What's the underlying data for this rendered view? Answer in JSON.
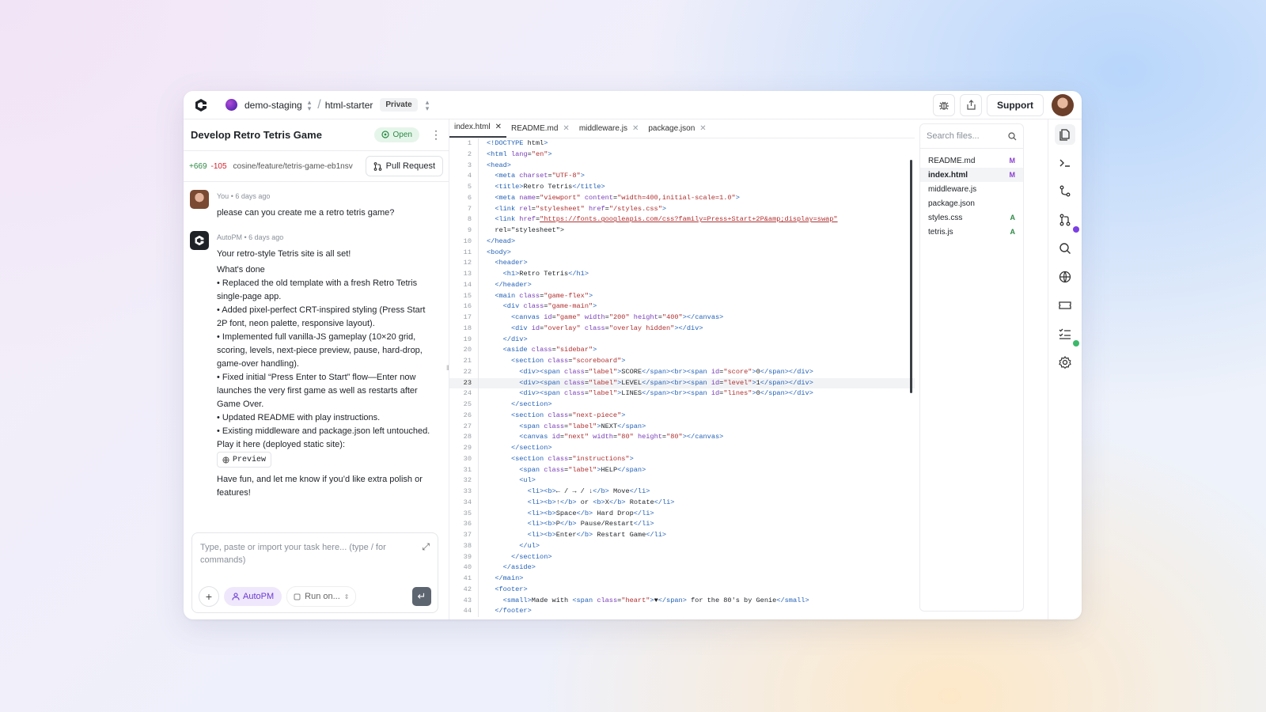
{
  "header": {
    "workspace": "demo-staging",
    "repo": "html-starter",
    "visibility": "Private",
    "support_label": "Support"
  },
  "task": {
    "title": "Develop Retro Tetris Game",
    "status": "Open",
    "additions": "+669",
    "deletions": "-105",
    "branch": "cosine/feature/tetris-game-eb1nsv",
    "pr_label": "Pull Request"
  },
  "messages": [
    {
      "author": "You",
      "time": "6 days ago",
      "lines": [
        "please can you create me a retro tetris game?"
      ]
    },
    {
      "author": "AutoPM",
      "time": "6 days ago",
      "lines": [
        "Your retro-style Tetris site is all set!",
        "What's done",
        "• Replaced the old template with a fresh Retro Tetris single-page app.",
        "• Added pixel-perfect CRT-inspired styling (Press Start 2P font, neon palette, responsive layout).",
        "• Implemented full vanilla-JS gameplay (10×20 grid, scoring, levels, next-piece preview, pause, hard-drop, game-over handling).",
        "• Fixed initial “Press Enter to Start” flow—Enter now launches the very first game as well as restarts after Game Over.",
        "• Updated README with play instructions.",
        "• Existing middleware and package.json left untouched.",
        "Play it here (deployed static site):"
      ],
      "preview_label": "Preview",
      "closing": "Have fun, and let me know if you’d like extra polish or features!"
    }
  ],
  "composer": {
    "placeholder": "Type, paste or import your task here... (type / for commands)",
    "agent_label": "AutoPM",
    "run_label": "Run on..."
  },
  "tabs": [
    {
      "label": "index.html",
      "active": true
    },
    {
      "label": "README.md",
      "active": false
    },
    {
      "label": "middleware.js",
      "active": false
    },
    {
      "label": "package.json",
      "active": false
    }
  ],
  "code": {
    "current_line": 23,
    "lines": [
      "<!DOCTYPE html>",
      "<html lang=\"en\">",
      "<head>",
      "  <meta charset=\"UTF-8\">",
      "  <title>Retro Tetris</title>",
      "  <meta name=\"viewport\" content=\"width=400,initial-scale=1.0\">",
      "  <link rel=\"stylesheet\" href=\"/styles.css\">",
      "  <link href=\"https://fonts.googleapis.com/css?family=Press+Start+2P&amp;display=swap\"",
      "  rel=\"stylesheet\">",
      "</head>",
      "<body>",
      "  <header>",
      "    <h1>Retro Tetris</h1>",
      "  </header>",
      "  <main class=\"game-flex\">",
      "    <div class=\"game-main\">",
      "      <canvas id=\"game\" width=\"200\" height=\"400\"></canvas>",
      "      <div id=\"overlay\" class=\"overlay hidden\"></div>",
      "    </div>",
      "    <aside class=\"sidebar\">",
      "      <section class=\"scoreboard\">",
      "        <div><span class=\"label\">SCORE</span><br><span id=\"score\">0</span></div>",
      "        <div><span class=\"label\">LEVEL</span><br><span id=\"level\">1</span></div>",
      "        <div><span class=\"label\">LINES</span><br><span id=\"lines\">0</span></div>",
      "      </section>",
      "      <section class=\"next-piece\">",
      "        <span class=\"label\">NEXT</span>",
      "        <canvas id=\"next\" width=\"80\" height=\"80\"></canvas>",
      "      </section>",
      "      <section class=\"instructions\">",
      "        <span class=\"label\">HELP</span>",
      "        <ul>",
      "          <li><b>← / → / ↓</b> Move</li>",
      "          <li><b>↑</b> or <b>X</b> Rotate</li>",
      "          <li><b>Space</b> Hard Drop</li>",
      "          <li><b>P</b> Pause/Restart</li>",
      "          <li><b>Enter</b> Restart Game</li>",
      "        </ul>",
      "      </section>",
      "    </aside>",
      "  </main>",
      "  <footer>",
      "    <small>Made with <span class=\"heart\">♥</span> for the 80's by Genie</small>",
      "  </footer>"
    ]
  },
  "files": {
    "search_placeholder": "Search files...",
    "items": [
      {
        "name": "README.md",
        "status": "M",
        "active": false
      },
      {
        "name": "index.html",
        "status": "M",
        "active": true
      },
      {
        "name": "middleware.js",
        "status": "",
        "active": false
      },
      {
        "name": "package.json",
        "status": "",
        "active": false
      },
      {
        "name": "styles.css",
        "status": "A",
        "active": false
      },
      {
        "name": "tetris.js",
        "status": "A",
        "active": false
      }
    ]
  },
  "rail": [
    {
      "icon": "files-icon",
      "active": true
    },
    {
      "icon": "terminal-icon",
      "active": false
    },
    {
      "icon": "git-branch-icon",
      "active": false
    },
    {
      "icon": "pull-request-icon",
      "active": false,
      "dot": "#7b3fe4"
    },
    {
      "icon": "search-icon",
      "active": false
    },
    {
      "icon": "globe-icon",
      "active": false
    },
    {
      "icon": "ticket-icon",
      "active": false
    },
    {
      "icon": "checklist-icon",
      "active": false,
      "dot": "#3cb86a"
    },
    {
      "icon": "settings-icon",
      "active": false
    }
  ]
}
